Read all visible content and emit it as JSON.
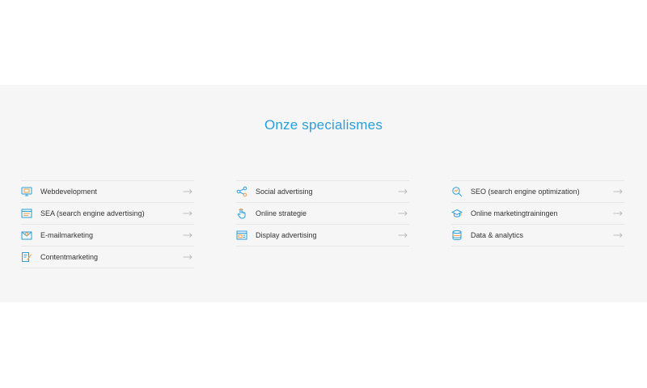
{
  "section": {
    "title": "Onze specialismes"
  },
  "columns": [
    {
      "items": [
        {
          "label": "Webdevelopment",
          "icon": "monitor-icon"
        },
        {
          "label": "SEA (search engine advertising)",
          "icon": "browser-ad-icon"
        },
        {
          "label": "E-mailmarketing",
          "icon": "envelope-icon"
        },
        {
          "label": "Contentmarketing",
          "icon": "pencil-document-icon"
        }
      ]
    },
    {
      "items": [
        {
          "label": "Social advertising",
          "icon": "share-icon"
        },
        {
          "label": "Online strategie",
          "icon": "hand-pointer-icon"
        },
        {
          "label": "Display advertising",
          "icon": "display-banner-icon"
        }
      ]
    },
    {
      "items": [
        {
          "label": "SEO (search engine optimization)",
          "icon": "magnifier-icon"
        },
        {
          "label": "Online marketingtrainingen",
          "icon": "graduation-cap-icon"
        },
        {
          "label": "Data & analytics",
          "icon": "database-icon"
        }
      ]
    }
  ],
  "colors": {
    "accent": "#2b9fd8",
    "icon_orange": "#f0a04b",
    "band_bg": "#f6f6f6",
    "divider": "#e6e6e6",
    "text": "#333333",
    "arrow": "#b8b8b8"
  }
}
